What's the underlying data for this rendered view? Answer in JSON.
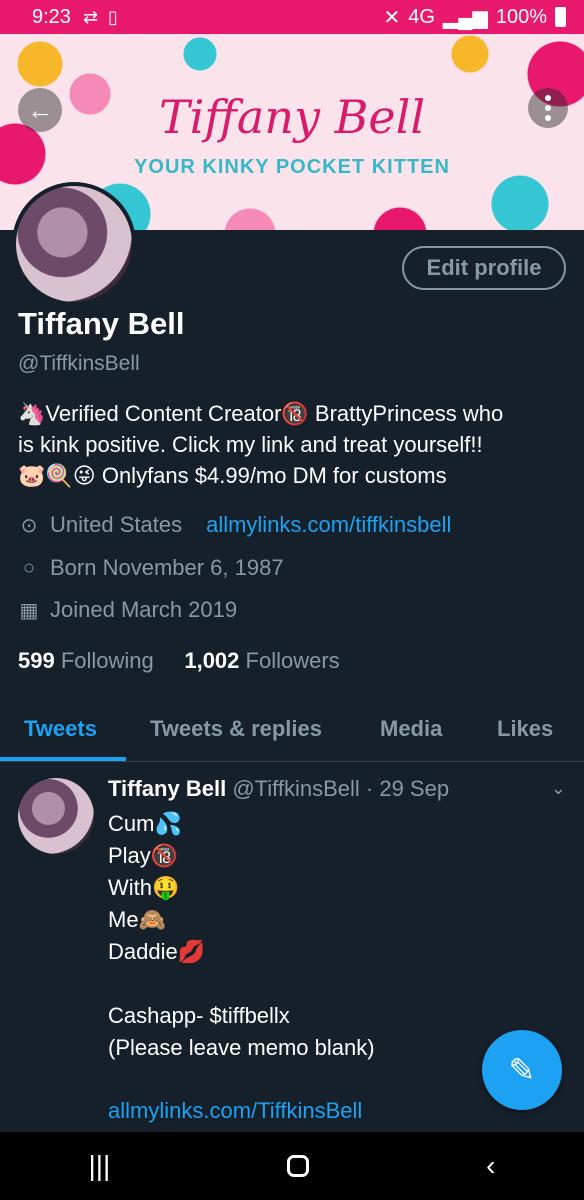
{
  "status_bar": {
    "time": "9:23",
    "battery": "100%",
    "network": "4G"
  },
  "banner": {
    "title": "Tiffany Bell",
    "subtitle": "YOUR KINKY POCKET KITTEN"
  },
  "profile": {
    "edit_label": "Edit profile",
    "name": "Tiffany Bell",
    "handle": "@TiffkinsBell",
    "bio_lines": [
      "🦄Verified Content Creator🔞 BrattyPrincess who",
      "is kink positive. Click my link and treat yourself!!",
      "🐷🍭😜  Onlyfans $4.99/mo DM for customs"
    ],
    "location": "United States",
    "website": "allmylinks.com/tiffkinsbell",
    "born": "Born November 6, 1987",
    "joined": "Joined March 2019",
    "following_count": "599",
    "following_label": "Following",
    "followers_count": "1,002",
    "followers_label": "Followers"
  },
  "tabs": [
    {
      "label": "Tweets"
    },
    {
      "label": "Tweets & replies"
    },
    {
      "label": "Media"
    },
    {
      "label": "Likes"
    }
  ],
  "tweet": {
    "author": "Tiffany Bell",
    "meta": "@TiffkinsBell · 29 Sep",
    "body": "Cum💦\nPlay🔞\nWith🤑\nMe🙈\nDaddie💋\n\nCashapp- $tiffbellx\n(Please leave memo blank)",
    "link": "allmylinks.com/TiffkinsBell"
  },
  "colors": {
    "accent": "#1da1f2",
    "background": "#15202b",
    "status_bar": "#e8196c"
  }
}
